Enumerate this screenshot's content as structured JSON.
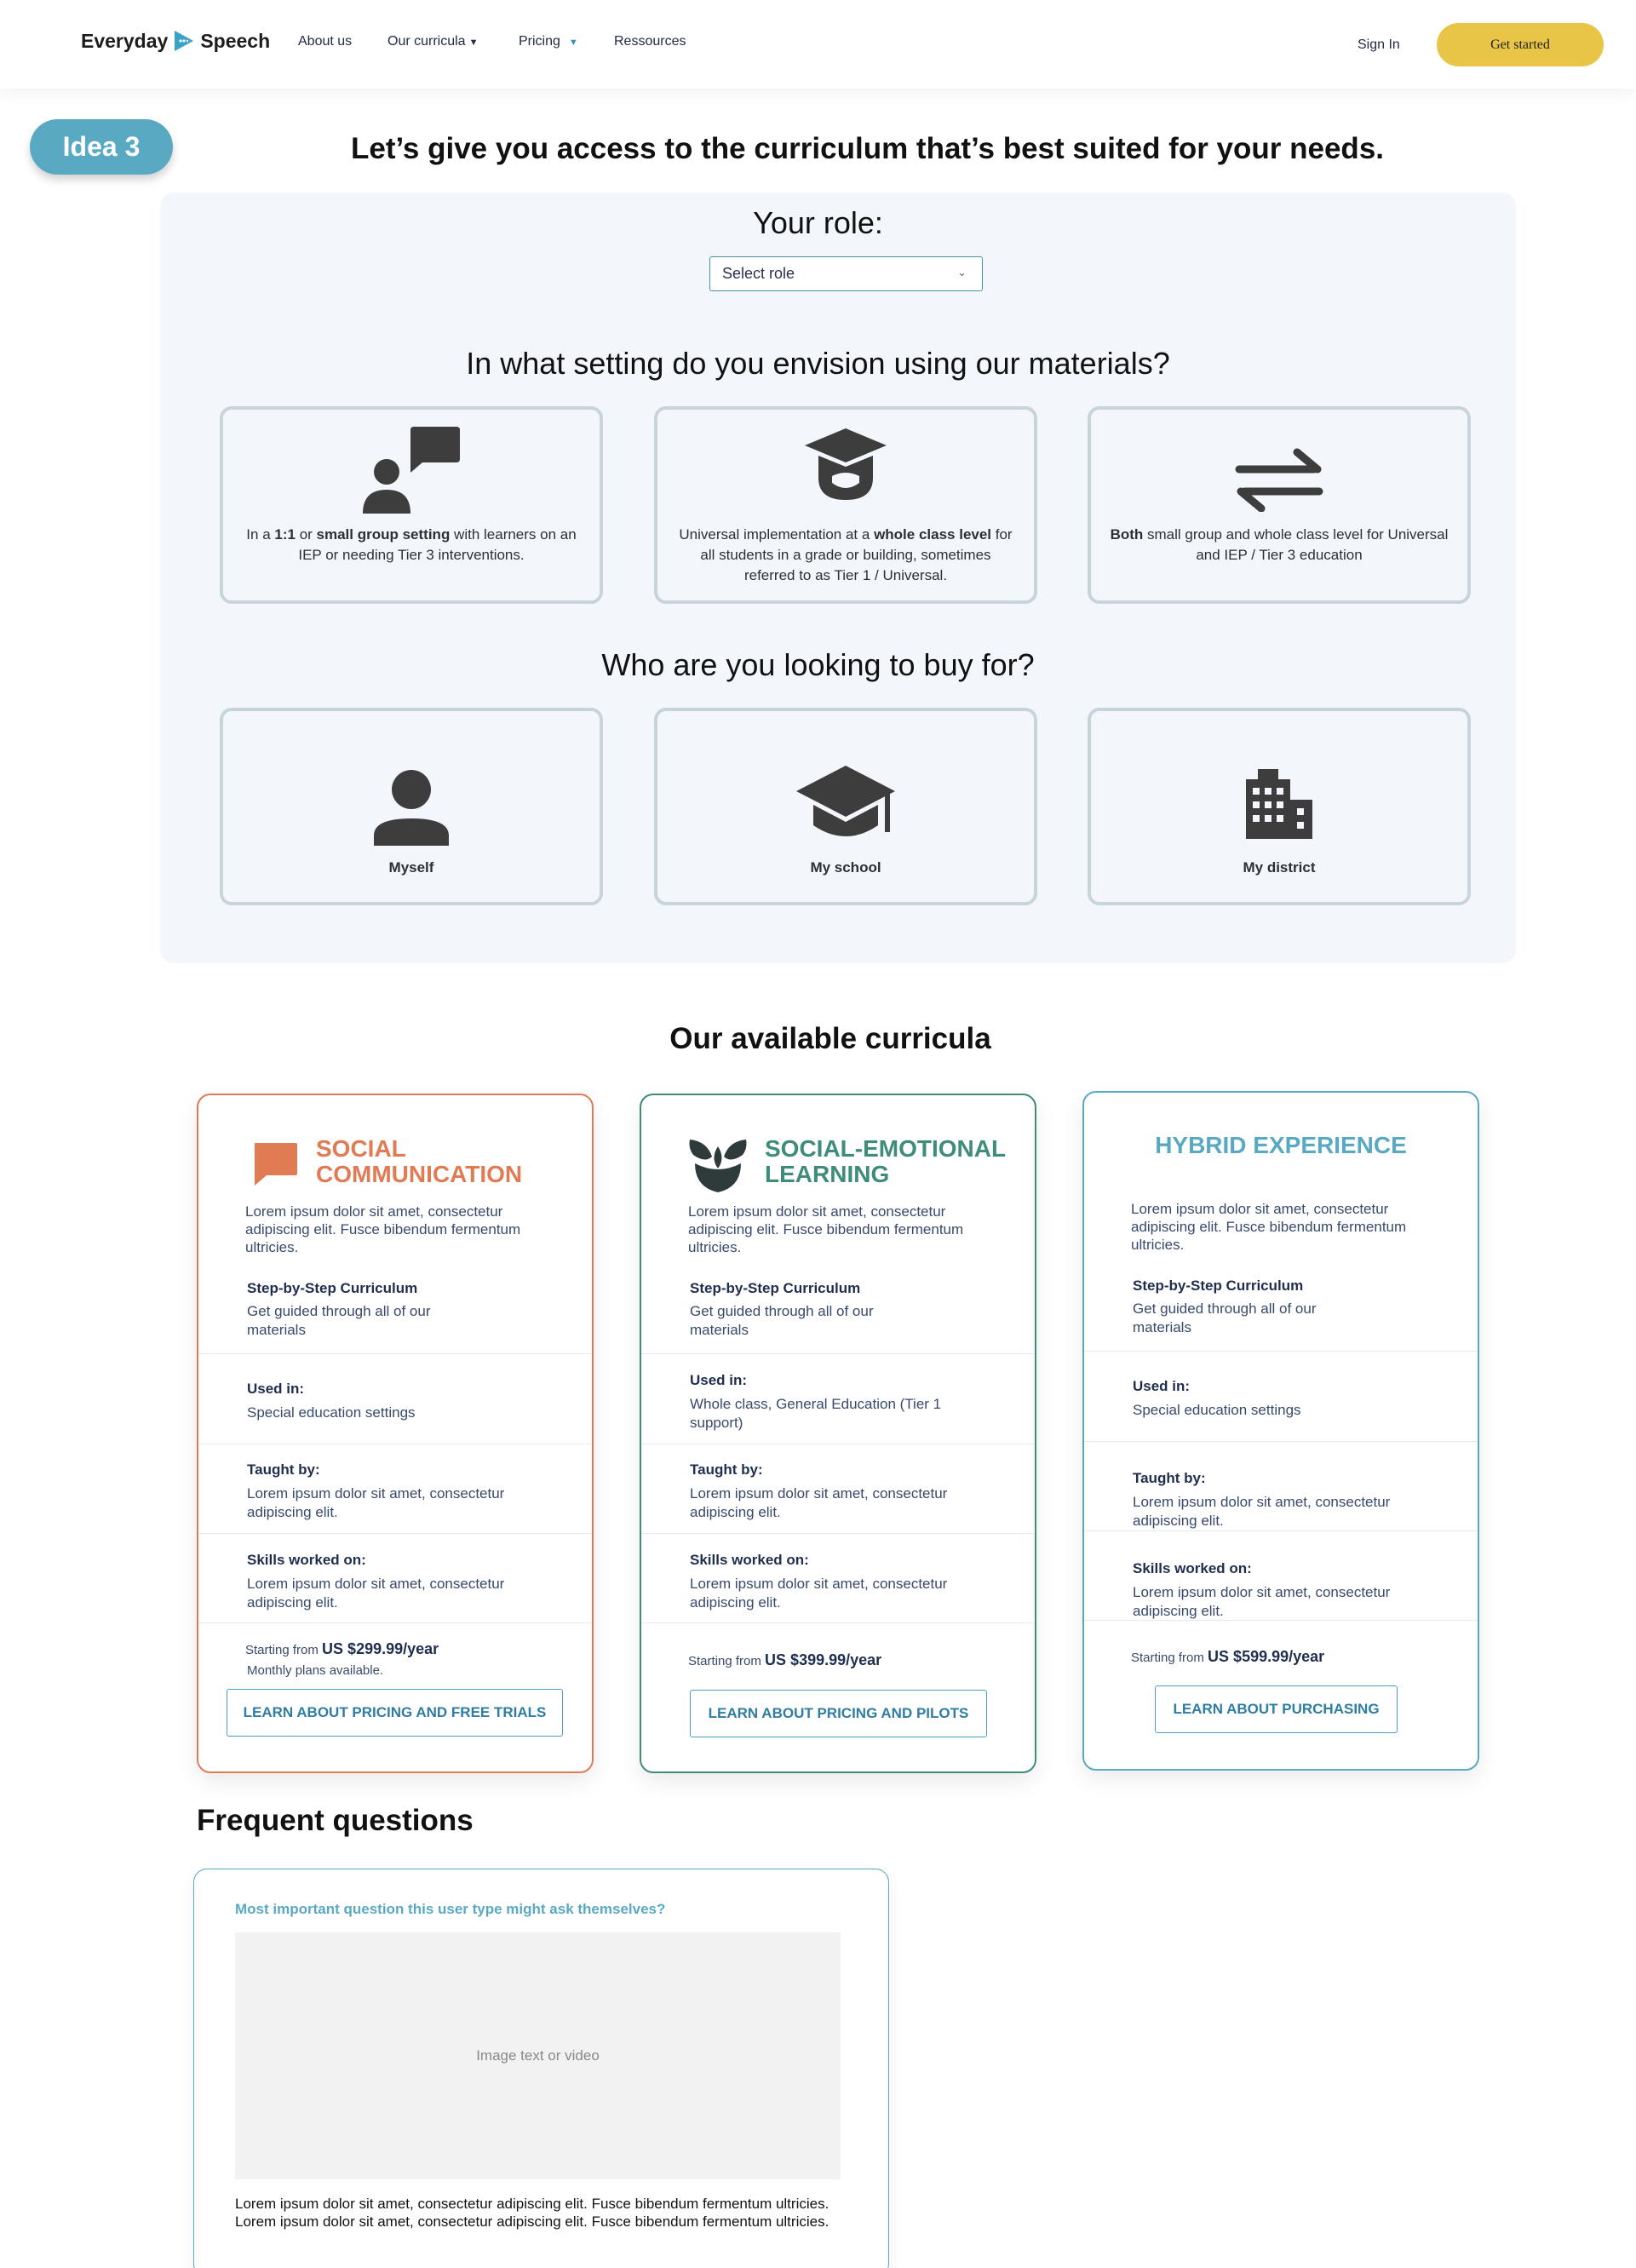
{
  "nav": {
    "brand_left": "Everyday",
    "brand_right": "Speech",
    "links": [
      "About us",
      "Our curricula",
      "Pricing",
      "Ressources"
    ],
    "signin": "Sign In",
    "cta": "Get started"
  },
  "idea_badge": "Idea 3",
  "headline": "Let’s give you access to the curriculum that’s best suited for your needs.",
  "role": {
    "title": "Your role:",
    "select_value": "Select role"
  },
  "setting": {
    "title": "In what setting do you envision using our materials?",
    "options": [
      {
        "icon": "person-speech-icon",
        "parts": [
          "In a ",
          "1:1",
          " or ",
          "small group setting",
          " with learners on an IEP or needing Tier 3 interventions."
        ]
      },
      {
        "icon": "graduation-cap-icon",
        "parts": [
          "Universal implementation at a ",
          "whole class level",
          " for all students in a grade or building, sometimes referred to as Tier 1 / Universal."
        ]
      },
      {
        "icon": "swap-arrows-icon",
        "parts": [
          "Both",
          " small group and whole class level for Universal and IEP / Tier 3 education"
        ]
      }
    ]
  },
  "buyer": {
    "title": "Who are you looking to buy for?",
    "options": [
      {
        "icon": "person-icon",
        "label": "Myself"
      },
      {
        "icon": "school-cap-icon",
        "label": "My school"
      },
      {
        "icon": "building-icon",
        "label": "My district"
      }
    ]
  },
  "curricula": {
    "title": "Our available curricula",
    "cards": [
      {
        "title_line1": "SOCIAL",
        "title_line2": "COMMUNICATION",
        "accent": "#e07b53",
        "icon": "speech-bubble-icon",
        "desc": "Lorem ipsum dolor sit amet, consectetur adipiscing elit. Fusce bibendum fermentum ultricies.",
        "step_head": "Step-by-Step Curriculum",
        "step_val": "Get guided through all of our materials",
        "used_head": "Used in:",
        "used_val": "Special education settings",
        "taught_head": "Taught by:",
        "taught_val": "Lorem ipsum dolor sit amet, consectetur adipiscing elit.",
        "skills_head": "Skills worked on:",
        "skills_val": "Lorem ipsum dolor sit amet, consectetur adipiscing elit.",
        "price_prefix": "Starting from",
        "price": "US $299.99/year",
        "note": "Monthly plans available.",
        "button": "LEARN ABOUT PRICING AND FREE TRIALS"
      },
      {
        "title_line1": "SOCIAL-EMOTIONAL",
        "title_line2": "LEARNING",
        "accent": "#3e8c7a",
        "icon": "lotus-icon",
        "desc": "Lorem ipsum dolor sit amet, consectetur adipiscing elit. Fusce bibendum fermentum ultricies.",
        "step_head": "Step-by-Step Curriculum",
        "step_val": "Get guided through all of our materials",
        "used_head": "Used in:",
        "used_val": "Whole class, General Education (Tier 1 support)",
        "taught_head": "Taught by:",
        "taught_val": "Lorem ipsum dolor sit amet, consectetur adipiscing elit.",
        "skills_head": "Skills worked on:",
        "skills_val": "Lorem ipsum dolor sit amet, consectetur adipiscing elit.",
        "price_prefix": "Starting from",
        "price": "US $399.99/year",
        "button": "LEARN ABOUT PRICING AND PILOTS"
      },
      {
        "title_line1": "HYBRID EXPERIENCE",
        "accent": "#5aa9c3",
        "desc": "Lorem ipsum dolor sit amet, consectetur adipiscing elit. Fusce bibendum fermentum ultricies.",
        "step_head": "Step-by-Step Curriculum",
        "step_val": "Get guided through all of our materials",
        "used_head": "Used in:",
        "used_val": "Special education settings",
        "taught_head": "Taught by:",
        "taught_val": "Lorem ipsum dolor sit amet, consectetur adipiscing elit.",
        "skills_head": "Skills worked on:",
        "skills_val": "Lorem ipsum dolor sit amet, consectetur adipiscing elit.",
        "price_prefix": "Starting from",
        "price": "US $599.99/year",
        "button": "LEARN ABOUT PURCHASING"
      }
    ]
  },
  "faq": {
    "title": "Frequent questions",
    "question": "Most important question this user type might ask themselves?",
    "media_placeholder": "Image text or video",
    "answer": "Lorem ipsum dolor sit amet, consectetur adipiscing elit. Fusce bibendum fermentum ultricies. Lorem ipsum dolor sit amet, consectetur adipiscing elit. Fusce bibendum fermentum ultricies."
  }
}
